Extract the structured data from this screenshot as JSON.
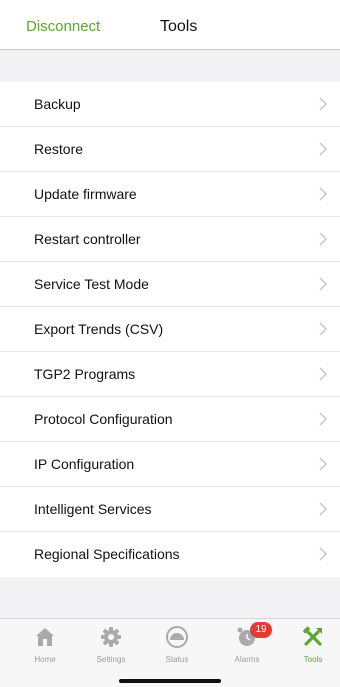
{
  "nav": {
    "left_label": "Disconnect",
    "title": "Tools"
  },
  "menu": {
    "items": [
      {
        "label": "Backup"
      },
      {
        "label": "Restore"
      },
      {
        "label": "Update firmware"
      },
      {
        "label": "Restart controller"
      },
      {
        "label": "Service Test Mode"
      },
      {
        "label": "Export Trends (CSV)"
      },
      {
        "label": "TGP2 Programs"
      },
      {
        "label": "Protocol Configuration"
      },
      {
        "label": "IP Configuration"
      },
      {
        "label": "Intelligent Services"
      },
      {
        "label": "Regional Specifications"
      }
    ]
  },
  "tabbar": {
    "tabs": [
      {
        "label": "Home",
        "icon": "home-icon"
      },
      {
        "label": "Settings",
        "icon": "gear-icon"
      },
      {
        "label": "Status",
        "icon": "gauge-icon"
      },
      {
        "label": "Alarms",
        "icon": "alarm-clock-icon",
        "badge": "19"
      },
      {
        "label": "Tools",
        "icon": "tools-icon",
        "active": true
      }
    ]
  },
  "colors": {
    "accent": "#5aa832",
    "badge": "#e33b33",
    "inactive": "#9a9aa0"
  }
}
